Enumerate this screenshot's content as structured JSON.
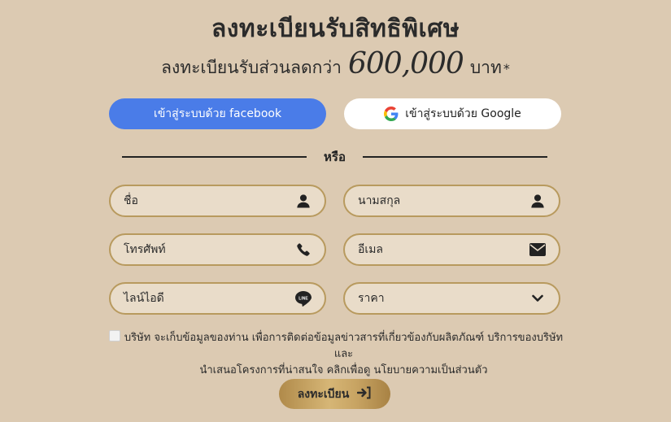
{
  "header": {
    "title": "ลงทะเบียนรับสิทธิพิเศษ",
    "subtitle_prefix": "ลงทะเบียนรับส่วนลดกว่า",
    "amount": "600,000",
    "subtitle_suffix": "บาท",
    "asterisk": "*"
  },
  "social": {
    "facebook_label": "เข้าสู่ระบบด้วย facebook",
    "google_label": "เข้าสู่ระบบด้วย Google",
    "facebook_color": "#4a7ce8"
  },
  "divider": {
    "or_label": "หรือ"
  },
  "form": {
    "first_name": {
      "placeholder": "ชื่อ",
      "icon": "user-icon"
    },
    "last_name": {
      "placeholder": "นามสกุล",
      "icon": "user-icon"
    },
    "phone": {
      "placeholder": "โทรศัพท์",
      "icon": "phone-icon"
    },
    "email": {
      "placeholder": "อีเมล",
      "icon": "envelope-icon"
    },
    "line_id": {
      "placeholder": "ไลน์ไอดี",
      "icon": "line-icon"
    },
    "price": {
      "placeholder": "ราคา",
      "icon": "chevron-down-icon"
    }
  },
  "consent": {
    "checked": false,
    "line1": "บริษัท จะเก็บข้อมูลของท่าน เพื่อการติดต่อข้อมูลข่าวสารที่เกี่ยวข้องกับผลิตภัณฑ์ บริการของบริษัท และ",
    "line2": "นำเสนอโครงการที่น่าสนใจ คลิกเพื่อดู นโยบายความเป็นส่วนตัว"
  },
  "submit": {
    "label": "ลงทะเบียน",
    "icon": "sign-in-icon"
  },
  "colors": {
    "background": "#dccab2",
    "field_border": "#b89a5e",
    "field_bg": "#e9dcc9",
    "gold": "#c7a362"
  }
}
